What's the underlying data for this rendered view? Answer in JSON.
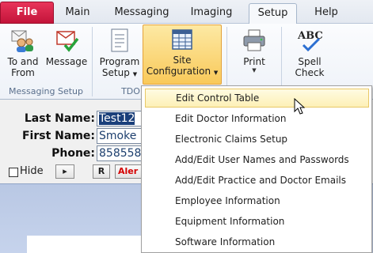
{
  "tabs": [
    "File",
    "Main",
    "Messaging",
    "Imaging",
    "Setup",
    "Help"
  ],
  "active_tab": "Setup",
  "ribbon": {
    "to_and_from_line1": "To and",
    "to_and_from_line2": "From",
    "message": "Message",
    "program_setup_line1": "Program",
    "program_setup_line2": "Setup",
    "site_config_line1": "Site",
    "site_config_line2": "Configuration",
    "print": "Print",
    "spell_check_line1": "Spell",
    "spell_check_line2": "Check",
    "abc_glyph": "ABC",
    "group_messaging": "Messaging Setup",
    "group_tdo": "TDO"
  },
  "form": {
    "last_name_label": "Last Name:",
    "last_name_value": "Test12",
    "first_name_label": "First Name:",
    "first_name_value": "Smoke",
    "phone_label": "Phone:",
    "phone_value": "858558",
    "hide_label": "Hide",
    "play_btn": "▸",
    "r_btn": "R",
    "alert_label": "Aler"
  },
  "menu": {
    "items": [
      "Edit Control Table",
      "Edit Doctor Information",
      "Electronic Claims Setup",
      "Add/Edit User Names and Passwords",
      "Add/Edit Practice and Doctor Emails",
      "Employee Information",
      "Equipment Information",
      "Software Information"
    ],
    "hovered_index": 0
  },
  "colors": {
    "file_tab": "#d42248",
    "highlight": "#f9c95a",
    "alert": "#d40000",
    "selected_text_bg": "#1a3f7a"
  }
}
